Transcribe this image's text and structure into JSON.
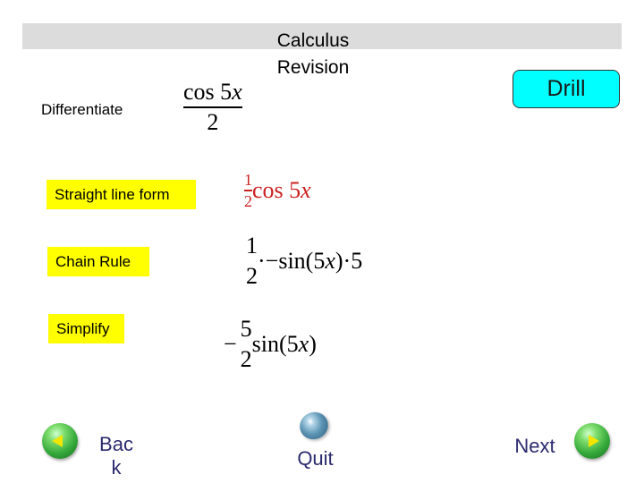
{
  "header": {
    "title_line1": "Calculus",
    "title_line2": "Revision",
    "title_bar_color": "#dcdcdc"
  },
  "task": {
    "label": "Differentiate",
    "expression": {
      "numerator": "cos 5x",
      "num_func": "cos 5",
      "num_var": "x",
      "denominator": "2"
    }
  },
  "drill_button": {
    "label": "Drill",
    "color": "#00ffff"
  },
  "steps": [
    {
      "label": "Straight line form",
      "color": "#ffff00",
      "expression": {
        "frac_num": "1",
        "frac_den": "2",
        "func": "cos 5",
        "var": "x",
        "text_color": "#cc1f1f"
      }
    },
    {
      "label": "Chain Rule",
      "color": "#ffff00",
      "expression": {
        "frac_num": "1",
        "frac_den": "2",
        "prefix": "·−sin(5",
        "var": "x",
        "suffix": ")·5"
      }
    },
    {
      "label": "Simplify",
      "color": "#ffff00",
      "expression": {
        "sign": "−",
        "frac_num": "5",
        "frac_den": "2",
        "prefix": "sin(5",
        "var": "x",
        "suffix": ")"
      }
    }
  ],
  "navigation": {
    "back": {
      "label_line1": "Bac",
      "label_line2": "k",
      "icon": "green-left-arrow-orb"
    },
    "quit": {
      "label": "Quit",
      "icon": "blue-orb"
    },
    "next": {
      "label": "Next",
      "icon": "green-right-arrow-orb"
    },
    "text_color": "#2b2a6e"
  }
}
